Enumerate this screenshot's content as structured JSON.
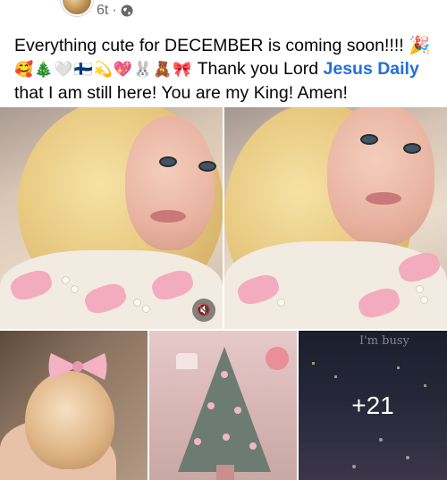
{
  "post": {
    "time": "6t",
    "separator": "·",
    "privacy_icon": "globe-icon",
    "text_line1": "Everything cute for DECEMBER is coming soon!!!! 🎉",
    "emojis": "🥰🎄🤍🇫🇮💫💖🐰🧸🎀",
    "text_thanks": "  Thank you Lord ",
    "mention": "Jesus Daily",
    "text_line3": "that I am still here! You are my King! Amen!"
  },
  "media": {
    "video_mute_icon": "speaker-muted-icon",
    "busy_caption": "I'm busy",
    "more_count": "+21"
  },
  "colors": {
    "mention": "#216fdb",
    "meta": "#65676b",
    "text": "#050505"
  }
}
